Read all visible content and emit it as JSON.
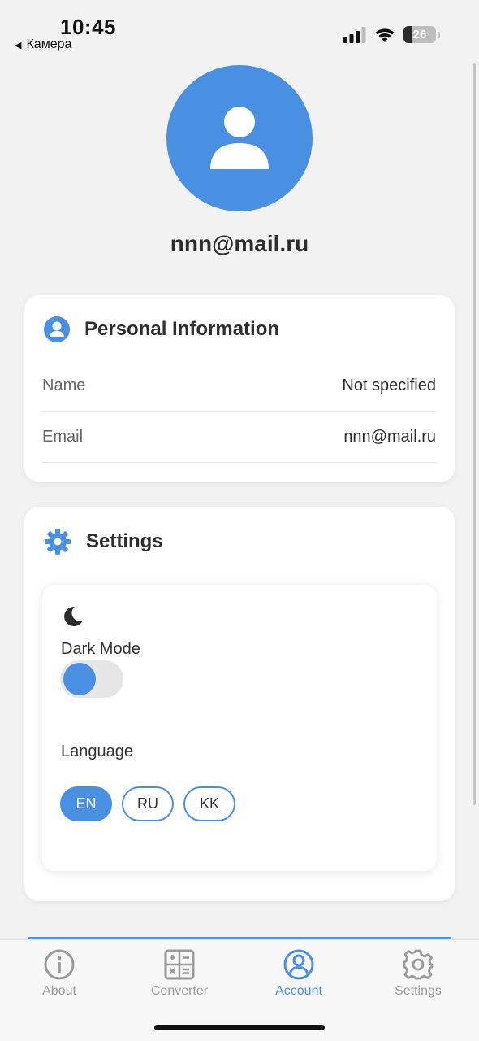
{
  "status_bar": {
    "time": "10:45",
    "back_app": "Камера",
    "battery": "26"
  },
  "profile": {
    "email": "nnn@mail.ru",
    "avatar_icon": "user-icon",
    "accent_color": "#4a90e2"
  },
  "personal_info": {
    "title": "Personal Information",
    "rows": [
      {
        "label": "Name",
        "value": "Not specified"
      },
      {
        "label": "Email",
        "value": "nnn@mail.ru"
      }
    ]
  },
  "settings": {
    "title": "Settings",
    "dark_mode_label": "Dark Mode",
    "dark_mode_on": false,
    "language_label": "Language",
    "languages": [
      "EN",
      "RU",
      "KK"
    ],
    "selected_language": "EN"
  },
  "nav": {
    "items": [
      {
        "label": "About",
        "icon": "info-icon"
      },
      {
        "label": "Converter",
        "icon": "calculator-icon"
      },
      {
        "label": "Account",
        "icon": "account-icon"
      },
      {
        "label": "Settings",
        "icon": "gear-icon"
      }
    ],
    "active": "Account"
  }
}
